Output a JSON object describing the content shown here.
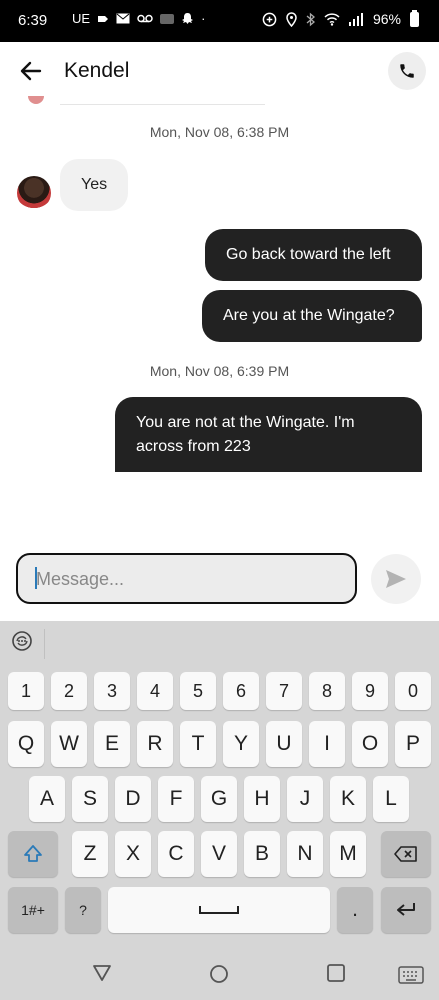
{
  "status_bar": {
    "time": "6:39",
    "carrier": "UE",
    "battery": "96%"
  },
  "header": {
    "contact_name": "Kendel"
  },
  "messages": {
    "timestamp_1": "Mon, Nov 08, 6:38 PM",
    "incoming_1": "Yes",
    "outgoing_1": "Go back toward the left",
    "outgoing_2": "Are you at the Wingate?",
    "timestamp_2": "Mon, Nov 08, 6:39 PM",
    "outgoing_3_line1": "You are not at the Wingate.  I'm",
    "outgoing_3_line2": "across from 223"
  },
  "composer": {
    "placeholder": "Message..."
  },
  "keyboard": {
    "row_numbers": [
      "1",
      "2",
      "3",
      "4",
      "5",
      "6",
      "7",
      "8",
      "9",
      "0"
    ],
    "row_1": [
      "Q",
      "W",
      "E",
      "R",
      "T",
      "Y",
      "U",
      "I",
      "O",
      "P"
    ],
    "row_2": [
      "A",
      "S",
      "D",
      "F",
      "G",
      "H",
      "J",
      "K",
      "L"
    ],
    "row_3": [
      "Z",
      "X",
      "C",
      "V",
      "B",
      "N",
      "M"
    ],
    "symbols_label": "1#+",
    "question_label": "?",
    "period_label": "."
  }
}
